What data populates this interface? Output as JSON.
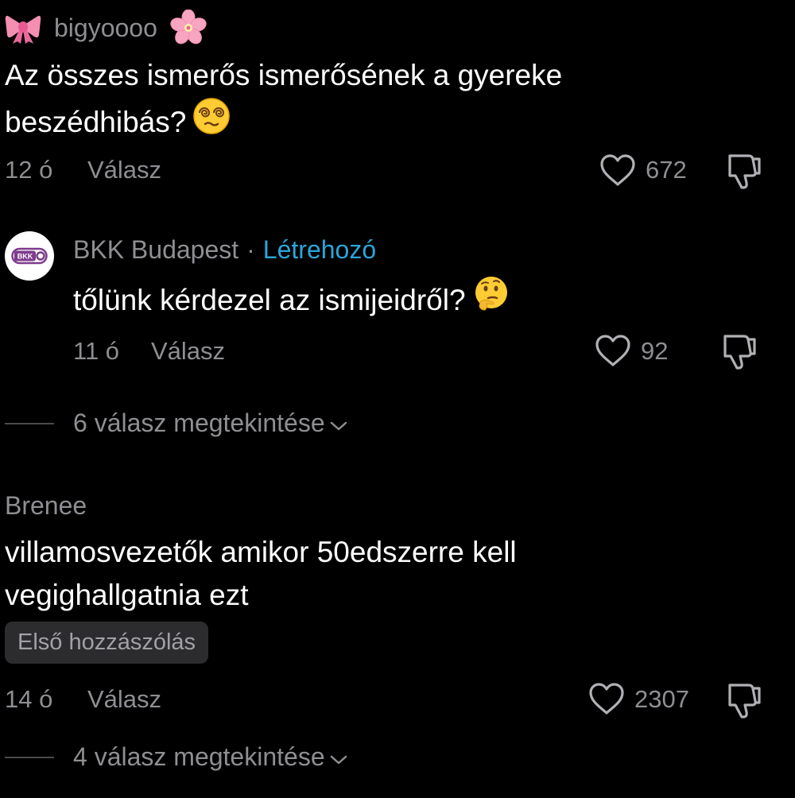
{
  "comments": [
    {
      "username": "bigyoooo",
      "prefix_emoji_icon": "ribbon-emoji",
      "suffix_emoji_icon": "cherry-blossom-emoji",
      "text_line1": "Az összes ismerős ismerősének a gyereke",
      "text_line2": "beszédhibás?",
      "text_emoji_icon": "face-with-spiral-eyes-emoji",
      "time": "12 ó",
      "reply_label": "Válasz",
      "likes": "672"
    },
    {
      "avatar_label": "BKK",
      "username": "BKK Budapest",
      "separator": "·",
      "creator_label": "Létrehozó",
      "text": "tőlünk kérdezel az ismijeidről?",
      "text_emoji_icon": "thinking-face-emoji",
      "time": "11 ó",
      "reply_label": "Válasz",
      "likes": "92",
      "view_replies": "6 válasz megtekintése"
    },
    {
      "username": "Brenee",
      "text_line1": "villamosvezetők amikor 50edszerre kell",
      "text_line2": "vegighallgatnia ezt",
      "badge": "Első hozzászólás",
      "time": "14 ó",
      "reply_label": "Válasz",
      "likes": "2307",
      "view_replies": "4 válasz megtekintése"
    }
  ],
  "colors": {
    "background": "#000000",
    "text": "#ffffff",
    "muted": "#8e8e93",
    "creator": "#2aa5d8",
    "bkk_purple": "#7d3c8c",
    "badge_bg": "#2c2c2e"
  }
}
